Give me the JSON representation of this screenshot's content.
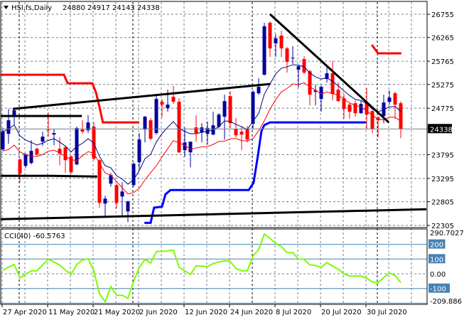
{
  "header": {
    "symbol_label": "HSI,fs,Daily",
    "ohlc_label": "24880 24917 24143 24338"
  },
  "indicator": {
    "label": "CCI(40) -60.5763"
  },
  "colors": {
    "bull": "#00009c",
    "bear": "#ff0000",
    "ma_fast": "#000080",
    "ma_slow": "#ff0000",
    "stop_upper": "#ff0000",
    "stop_lower": "#0000ff",
    "trendline": "#000000",
    "cci": "#7cfc00",
    "cci_levels": "#4682b4",
    "grid": "#708090"
  },
  "chart_data": [
    {
      "type": "candlestick",
      "title": "HSI,fs,Daily",
      "ylim": [
        22305,
        26755
      ],
      "y_ticks": [
        26755,
        26265,
        25765,
        25275,
        24775,
        23795,
        23295,
        22805,
        22305
      ],
      "current_price": 24338,
      "x_labels": [
        {
          "index": 0,
          "label": "27 Apr 2020"
        },
        {
          "index": 8,
          "label": "11 May 2020"
        },
        {
          "index": 16,
          "label": "21 May 2020"
        },
        {
          "index": 24,
          "label": "2 Jun 2020"
        },
        {
          "index": 32,
          "label": "12 Jun 2020"
        },
        {
          "index": 40,
          "label": "24 Jun 2020"
        },
        {
          "index": 48,
          "label": "8 Jul 2020"
        },
        {
          "index": 56,
          "label": "20 Jul 2020"
        },
        {
          "index": 64,
          "label": "30 Jul 2020"
        }
      ],
      "period_separators_index": [
        3,
        23,
        44,
        66
      ],
      "grid": true,
      "ohlc": [
        [
          23905,
          24355,
          23875,
          24280
        ],
        [
          24235,
          24760,
          24025,
          24520
        ],
        [
          24595,
          24775,
          24430,
          24730
        ],
        [
          23695,
          23725,
          23215,
          23395
        ],
        [
          23560,
          23830,
          23515,
          23800
        ],
        [
          23620,
          24100,
          23590,
          23875
        ],
        [
          23920,
          23950,
          23770,
          23800
        ],
        [
          24070,
          24280,
          23980,
          24175
        ],
        [
          24325,
          24685,
          24175,
          24310
        ],
        [
          24220,
          24340,
          23995,
          24250
        ],
        [
          23920,
          24160,
          23575,
          23815
        ],
        [
          23950,
          23980,
          23410,
          23680
        ],
        [
          23755,
          23785,
          23395,
          23425
        ],
        [
          23590,
          24385,
          23575,
          24355
        ],
        [
          24325,
          24520,
          24235,
          24280
        ],
        [
          24310,
          24625,
          24250,
          24475
        ],
        [
          24385,
          24475,
          23680,
          23710
        ],
        [
          23680,
          23700,
          22675,
          22780
        ],
        [
          22765,
          22930,
          22480,
          22870
        ],
        [
          23185,
          23410,
          23125,
          23365
        ],
        [
          23155,
          23185,
          22660,
          22780
        ],
        [
          22915,
          23215,
          22510,
          23020
        ],
        [
          22600,
          22825,
          22375,
          22810
        ],
        [
          23155,
          23635,
          23125,
          23605
        ],
        [
          23635,
          24250,
          23500,
          24115
        ],
        [
          24325,
          24610,
          24055,
          24595
        ],
        [
          24520,
          24565,
          24100,
          24130
        ],
        [
          24250,
          25060,
          24220,
          24970
        ],
        [
          24910,
          24970,
          24580,
          24850
        ],
        [
          24775,
          25165,
          24700,
          24850
        ],
        [
          25015,
          25240,
          24865,
          24910
        ],
        [
          24910,
          24985,
          23830,
          23845
        ],
        [
          23890,
          24370,
          23755,
          24055
        ],
        [
          23845,
          24070,
          23530,
          24070
        ],
        [
          24370,
          24625,
          24070,
          24250
        ],
        [
          24265,
          24460,
          24055,
          24370
        ],
        [
          24235,
          24490,
          24010,
          24355
        ],
        [
          24220,
          24700,
          24205,
          24415
        ],
        [
          24385,
          24670,
          24355,
          24640
        ],
        [
          24595,
          25060,
          24115,
          24925
        ],
        [
          25030,
          25135,
          24355,
          24460
        ],
        [
          24340,
          24565,
          24160,
          24205
        ],
        [
          24280,
          24400,
          23890,
          24220
        ],
        [
          24340,
          24400,
          24055,
          24115
        ],
        [
          24445,
          25150,
          24340,
          25120
        ],
        [
          25090,
          25405,
          25060,
          25225
        ],
        [
          25480,
          26575,
          25465,
          26500
        ],
        [
          26575,
          26605,
          25855,
          26035
        ],
        [
          26140,
          26335,
          25855,
          26245
        ],
        [
          26305,
          26410,
          25855,
          26035
        ],
        [
          26035,
          26065,
          25525,
          25750
        ],
        [
          25825,
          26080,
          25705,
          25840
        ],
        [
          25585,
          25690,
          25210,
          25660
        ],
        [
          25810,
          25870,
          25495,
          25525
        ],
        [
          25555,
          25585,
          24835,
          25060
        ],
        [
          25120,
          25270,
          24835,
          25150
        ],
        [
          24970,
          25255,
          24700,
          25225
        ],
        [
          25390,
          25630,
          25315,
          25510
        ],
        [
          25510,
          25765,
          24940,
          25075
        ],
        [
          25165,
          25315,
          24910,
          24925
        ],
        [
          24985,
          25075,
          24550,
          24760
        ],
        [
          24850,
          24880,
          24550,
          24700
        ],
        [
          24880,
          24940,
          24595,
          24670
        ],
        [
          24670,
          24925,
          24655,
          24865
        ],
        [
          24895,
          25195,
          24325,
          24640
        ],
        [
          24715,
          24730,
          24250,
          24340
        ],
        [
          24580,
          24610,
          24160,
          24520
        ],
        [
          24610,
          25060,
          24460,
          24895
        ],
        [
          24910,
          25150,
          24850,
          25000
        ],
        [
          25090,
          25120,
          24550,
          24850
        ],
        [
          24880,
          24917,
          24143,
          24338
        ]
      ],
      "moving_averages": [
        {
          "name": "fast",
          "source": "close",
          "period": 8
        },
        {
          "name": "slow",
          "source": "low",
          "period": 10
        }
      ],
      "step_lines": [
        {
          "name": "stop-upper-1",
          "points": [
            [
              -0.5,
              25480
            ],
            [
              10.75,
              25480
            ],
            [
              11.4,
              25300
            ],
            [
              15.75,
              25300
            ],
            [
              16.4,
              25100
            ],
            [
              17,
              24800
            ],
            [
              17.6,
              24475
            ],
            [
              24,
              24475
            ]
          ]
        },
        {
          "name": "stop-upper-2",
          "points": [
            [
              64.9,
              26110
            ],
            [
              66,
              25930
            ],
            [
              70.1,
              25930
            ]
          ]
        },
        {
          "name": "stop-lower",
          "points": [
            [
              24.9,
              22360
            ],
            [
              26,
              22360
            ],
            [
              26.6,
              22680
            ],
            [
              28,
              22700
            ],
            [
              28.6,
              22960
            ],
            [
              29.5,
              23050
            ],
            [
              43.25,
              23050
            ],
            [
              44.1,
              23200
            ],
            [
              44.9,
              23800
            ],
            [
              45.5,
              24300
            ],
            [
              46,
              24420
            ],
            [
              47,
              24475
            ],
            [
              63.9,
              24475
            ]
          ]
        }
      ],
      "trendlines": [
        {
          "name": "rising-resistance",
          "points": [
            [
              1.75,
              24760
            ],
            [
              47,
              25285
            ]
          ]
        },
        {
          "name": "horizontal-resistance",
          "points": [
            [
              -0.5,
              24610
            ],
            [
              13.9,
              24610
            ]
          ]
        },
        {
          "name": "horizontal-support",
          "points": [
            [
              -0.5,
              23350
            ],
            [
              8.5,
              23350
            ],
            [
              16.6,
              23335
            ]
          ]
        },
        {
          "name": "rising-support",
          "points": [
            [
              -0.5,
              22435
            ],
            [
              74.5,
              22645
            ]
          ]
        },
        {
          "name": "falling-resistance",
          "points": [
            [
              47,
              26755
            ],
            [
              67.9,
              24475
            ]
          ]
        }
      ]
    },
    {
      "type": "line",
      "title": "CCI(40)",
      "ylim": [
        -209.886,
        290.7027
      ],
      "max_label": "290.7027",
      "min_label": "-209.886",
      "levels": [
        {
          "value": 200,
          "label": "200",
          "boxed": true
        },
        {
          "value": 100,
          "label": "100",
          "boxed": true
        },
        {
          "value": 0,
          "label": "0.00",
          "boxed": false
        },
        {
          "value": -100,
          "label": "-100",
          "boxed": true
        },
        {
          "value": -200,
          "label": "",
          "boxed": false
        }
      ],
      "values": [
        24,
        45,
        63,
        -29,
        -3,
        20,
        20,
        60,
        98,
        80,
        59,
        25,
        -5,
        63,
        93,
        102,
        20,
        -137,
        -190,
        -88,
        -146,
        -146,
        -166,
        -54,
        44,
        98,
        73,
        151,
        152,
        156,
        161,
        44,
        20,
        -5,
        54,
        52,
        49,
        69,
        80,
        88,
        85,
        36,
        20,
        20,
        120,
        165,
        270,
        240,
        208,
        185,
        143,
        143,
        100,
        98,
        60,
        57,
        44,
        76,
        52,
        31,
        0,
        -16,
        -16,
        -16,
        -30,
        -56,
        -62,
        -25,
        5,
        -11,
        -60.5763
      ]
    }
  ]
}
